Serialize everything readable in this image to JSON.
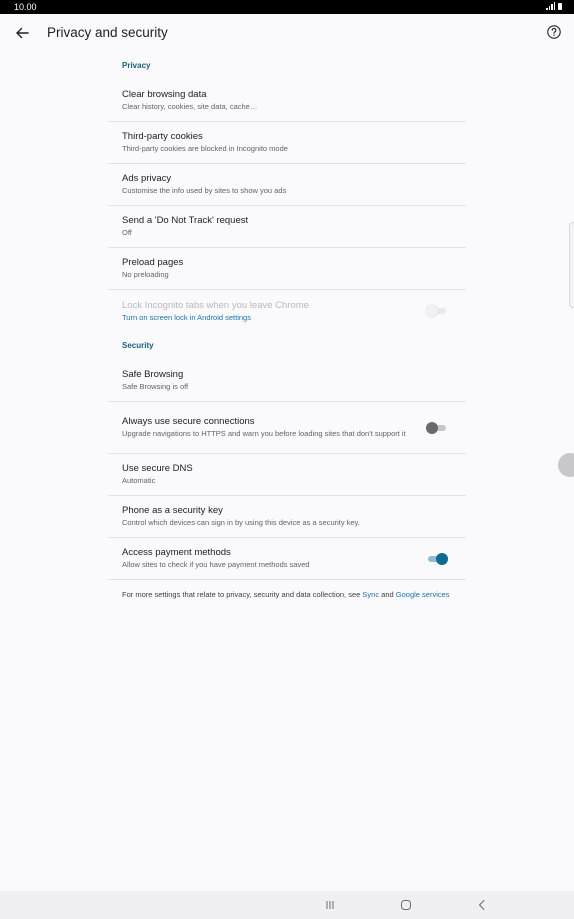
{
  "status_bar": {
    "time": "10.00"
  },
  "header": {
    "title": "Privacy and security"
  },
  "privacy": {
    "heading": "Privacy",
    "items": [
      {
        "title": "Clear browsing data",
        "subtitle": "Clear history, cookies, site data, cache…"
      },
      {
        "title": "Third-party cookies",
        "subtitle": "Third-party cookies are blocked in Incognito mode"
      },
      {
        "title": "Ads privacy",
        "subtitle": "Customise the info used by sites to show you ads"
      },
      {
        "title": "Send a 'Do Not Track' request",
        "subtitle": "Off"
      },
      {
        "title": "Preload pages",
        "subtitle": "No preloading"
      },
      {
        "title": "Lock Incognito tabs when you leave Chrome",
        "subtitle": "Turn on screen lock in Android settings",
        "toggle": "disabled"
      }
    ]
  },
  "security": {
    "heading": "Security",
    "items": [
      {
        "title": "Safe Browsing",
        "subtitle": "Safe Browsing is off"
      },
      {
        "title": "Always use secure connections",
        "subtitle": "Upgrade navigations to HTTPS and warn you before loading sites that don't support it",
        "toggle": "off"
      },
      {
        "title": "Use secure DNS",
        "subtitle": "Automatic"
      },
      {
        "title": "Phone as a security key",
        "subtitle": "Control which devices can sign in by using this device as a security key."
      },
      {
        "title": "Access payment methods",
        "subtitle": "Allow sites to check if you have payment methods saved",
        "toggle": "on"
      }
    ]
  },
  "footer": {
    "text_before": "For more settings that relate to privacy, security and data collection, see ",
    "link_sync": "Sync",
    "text_and": " and ",
    "link_google": "Google services"
  },
  "colors": {
    "accent": "#0e6a90",
    "link": "#1a73a8",
    "section_heading": "#1a5f7a"
  },
  "icons": {
    "back": "arrow-left-icon",
    "help": "help-circle-icon",
    "nav_recents": "recents-icon",
    "nav_home": "home-icon",
    "nav_back": "back-chevron-icon"
  }
}
